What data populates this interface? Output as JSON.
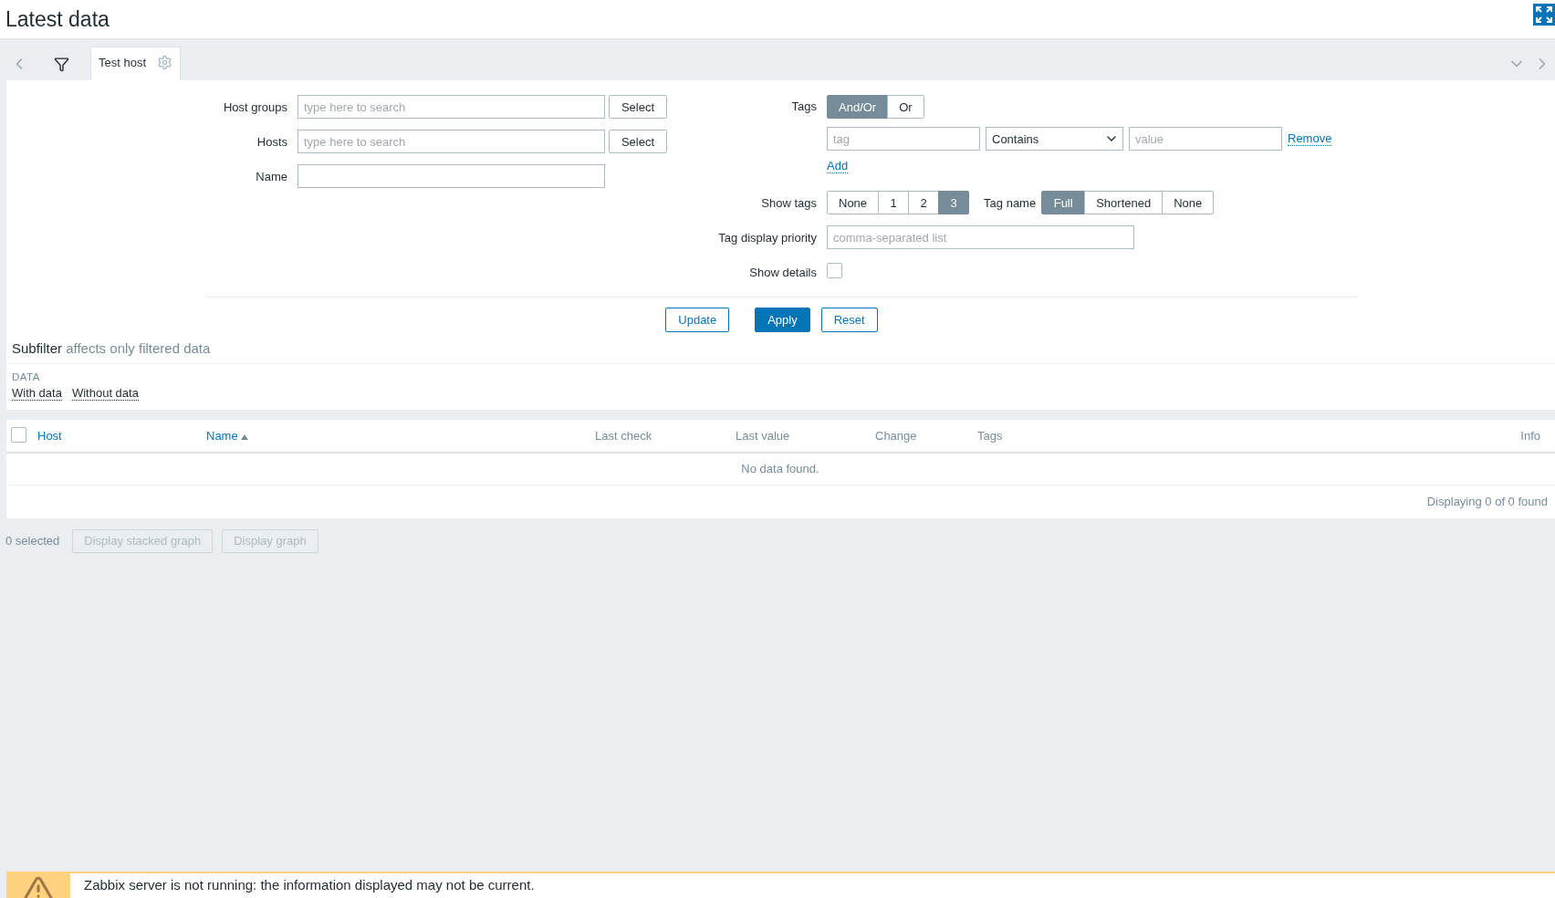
{
  "header": {
    "title": "Latest data"
  },
  "filter_tabs": [
    {
      "label": "Test host",
      "selected": true
    }
  ],
  "filter": {
    "fields": [
      {
        "label": "Host groups",
        "placeholder": "type here to search",
        "button": "Select"
      },
      {
        "label": "Hosts",
        "placeholder": "type here to search",
        "button": "Select"
      },
      {
        "label": "Name"
      }
    ],
    "tags": {
      "label": "Tags",
      "operator": [
        {
          "label": "And/Or",
          "selected": true
        },
        {
          "label": "Or",
          "selected": false
        }
      ],
      "rows": [
        {
          "tag_placeholder": "tag",
          "operator": "Contains",
          "value_placeholder": "value",
          "remove": "Remove"
        }
      ],
      "add": "Add"
    },
    "show_tags": {
      "label": "Show tags",
      "options": [
        {
          "label": "None",
          "selected": false
        },
        {
          "label": "1",
          "selected": false
        },
        {
          "label": "2",
          "selected": false
        },
        {
          "label": "3",
          "selected": true
        }
      ]
    },
    "tag_name": {
      "label": "Tag name",
      "options": [
        {
          "label": "Full",
          "selected": true
        },
        {
          "label": "Shortened",
          "selected": false
        },
        {
          "label": "None",
          "selected": false
        }
      ]
    },
    "tag_priority": {
      "label": "Tag display priority",
      "placeholder": "comma-separated list"
    },
    "show_details": {
      "label": "Show details",
      "checked": false
    },
    "buttons": [
      {
        "label": "Update",
        "kind": "secondary"
      },
      {
        "label": "Apply",
        "kind": "primary"
      },
      {
        "label": "Reset",
        "kind": "secondary"
      }
    ]
  },
  "subfilter": {
    "title": "Subfilter",
    "hint": "affects only filtered data",
    "groups": [
      {
        "label": "DATA",
        "links": [
          "With data",
          "Without data"
        ]
      }
    ]
  },
  "table": {
    "select_all": {
      "checked": false
    },
    "columns": [
      {
        "label": "Host",
        "kind": "link",
        "sorted": false
      },
      {
        "label": "Name",
        "kind": "link",
        "sorted": true
      },
      {
        "label": "Last check",
        "kind": "plain",
        "sorted": false
      },
      {
        "label": "Last value",
        "kind": "plain",
        "sorted": false
      },
      {
        "label": "Change",
        "kind": "plain",
        "sorted": false
      },
      {
        "label": "Tags",
        "kind": "plain",
        "sorted": false
      },
      {
        "label": "Info",
        "kind": "plain",
        "sorted": false
      }
    ],
    "empty_message": "No data found.",
    "footer": "Displaying 0 of 0 found"
  },
  "actions": {
    "selected_count": "0 selected",
    "buttons": [
      {
        "label": "Display stacked graph",
        "disabled": true
      },
      {
        "label": "Display graph",
        "disabled": true
      }
    ]
  },
  "warning": {
    "message": "Zabbix server is not running: the information displayed may not be current."
  }
}
